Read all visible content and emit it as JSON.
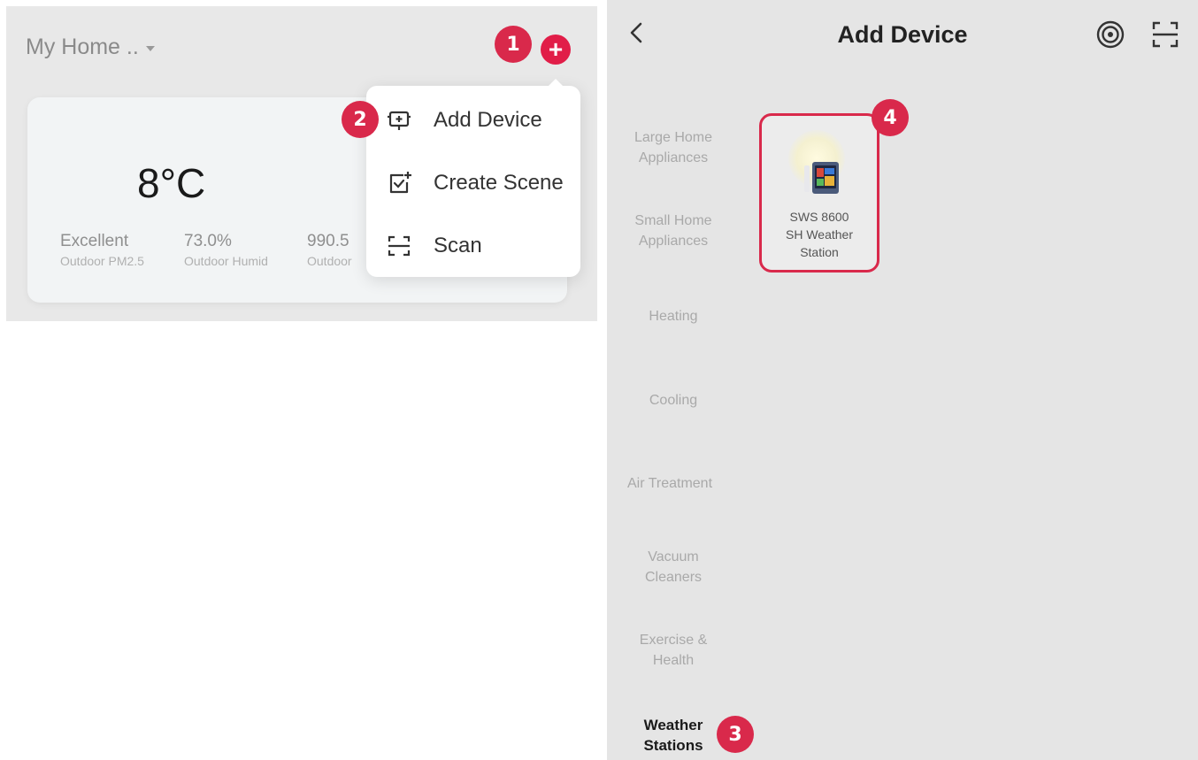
{
  "left_panel": {
    "home_selector": "My Home ..",
    "weather_card": {
      "temperature": "8°C",
      "stats": [
        {
          "value": "Excellent",
          "label": "Outdoor PM2.5"
        },
        {
          "value": "73.0%",
          "label": "Outdoor Humid"
        },
        {
          "value": "990.5",
          "label": "Outdoor"
        }
      ]
    },
    "menu": {
      "items": [
        {
          "label": "Add Device",
          "icon": "add-device-icon"
        },
        {
          "label": "Create Scene",
          "icon": "create-scene-icon"
        },
        {
          "label": "Scan",
          "icon": "scan-icon"
        }
      ]
    }
  },
  "right_panel": {
    "title": "Add Device",
    "categories": [
      "Large Home Appliances",
      "Small Home Appliances",
      "Heating",
      "Cooling",
      "Air Treatment",
      "Vacuum Cleaners",
      "Exercise & Health",
      "Weather Stations"
    ],
    "selected_category": "Weather Stations",
    "device": {
      "name_line1": "SWS 8600",
      "name_line2": "SH Weather",
      "name_line3": "Station"
    }
  },
  "steps": [
    "1",
    "2",
    "3",
    "4"
  ],
  "colors": {
    "accent": "#d9294b",
    "plus_button": "#e11d48",
    "panel_bg": "#e5e5e5"
  }
}
